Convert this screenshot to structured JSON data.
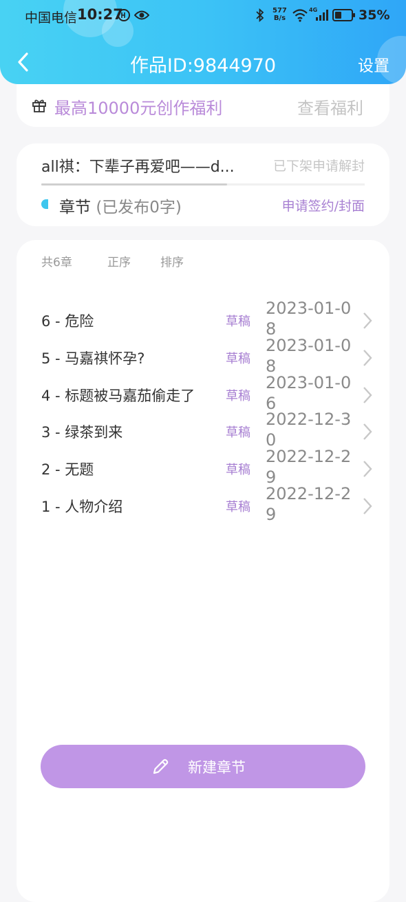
{
  "status_bar": {
    "carrier": "中国电信",
    "time": "10:27",
    "net_speed_value": "577",
    "net_speed_unit": "B/s",
    "network_type": "4G",
    "battery": "35%"
  },
  "nav": {
    "title": "作品ID:9844970",
    "settings_label": "设置"
  },
  "welfare": {
    "promo_text": "最高10000元创作福利",
    "link_text": "查看福利"
  },
  "work": {
    "title": "all祺：下辈子再爱吧——d...",
    "status_text": "已下架申请解封",
    "section_label": "章节",
    "section_sub": "(已发布0字)",
    "apply_link": "申请签约/封面"
  },
  "list": {
    "count_label": "共6章",
    "order_label": "正序",
    "sort_label": "排序",
    "chapters": [
      {
        "title": "6 - 危险",
        "status": "草稿",
        "date": "2023-01-08"
      },
      {
        "title": "5 - 马嘉祺怀孕?",
        "status": "草稿",
        "date": "2023-01-08"
      },
      {
        "title": "4 - 标题被马嘉茄偷走了",
        "status": "草稿",
        "date": "2023-01-06"
      },
      {
        "title": "3 - 绿茶到来",
        "status": "草稿",
        "date": "2022-12-30"
      },
      {
        "title": "2 - 无题",
        "status": "草稿",
        "date": "2022-12-29"
      },
      {
        "title": "1 - 人物介绍",
        "status": "草稿",
        "date": "2022-12-29"
      }
    ]
  },
  "new_chapter_button": "新建章节",
  "colors": {
    "header_gradient_start": "#48d2f3",
    "header_gradient_end": "#2fa6f7",
    "accent_purple": "#a77fd2",
    "button_purple": "#c096e6"
  }
}
